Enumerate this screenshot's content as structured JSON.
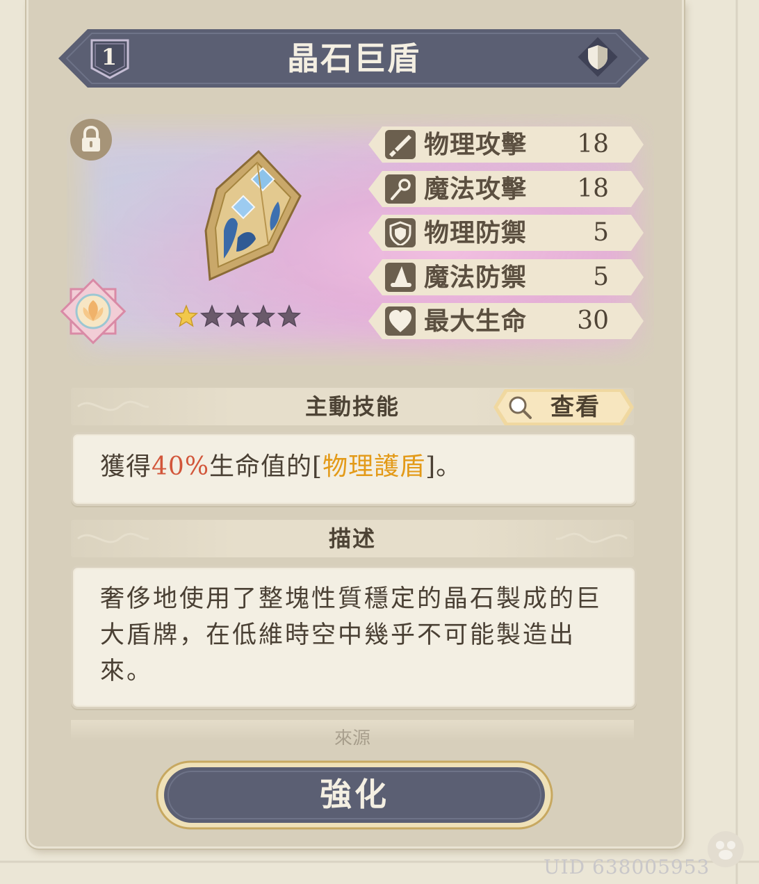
{
  "item": {
    "level": "1",
    "name": "晶石巨盾",
    "rarity_stars": 1,
    "max_stars": 5
  },
  "stats": [
    {
      "icon": "sword-icon",
      "label": "物理攻擊",
      "value": "18"
    },
    {
      "icon": "staff-icon",
      "label": "魔法攻擊",
      "value": "18"
    },
    {
      "icon": "shield-icon",
      "label": "物理防禦",
      "value": "5"
    },
    {
      "icon": "wizard-hat-icon",
      "label": "魔法防禦",
      "value": "5"
    },
    {
      "icon": "heart-icon",
      "label": "最大生命",
      "value": "30"
    }
  ],
  "active_skill": {
    "header": "主動技能",
    "view_label": "查看",
    "text_before": "獲得",
    "text_percent": "40%",
    "text_middle": "生命值的[",
    "text_highlight": "物理護盾",
    "text_after": "]。"
  },
  "description": {
    "header": "描述",
    "text": "奢侈地使用了整塊性質穩定的晶石製成的巨大盾牌，在低維時空中幾乎不可能製造出來。"
  },
  "next_section_header": "來源",
  "upgrade_label": "強化",
  "uid": "UID 638005953",
  "colors": {
    "banner": "#5b5f73",
    "stat_icon_bg": "#6b5f4e",
    "highlight_red": "#d2563a",
    "highlight_orange": "#e39a18",
    "star_filled": "#f2c84b",
    "star_empty": "#6a5a6a"
  }
}
